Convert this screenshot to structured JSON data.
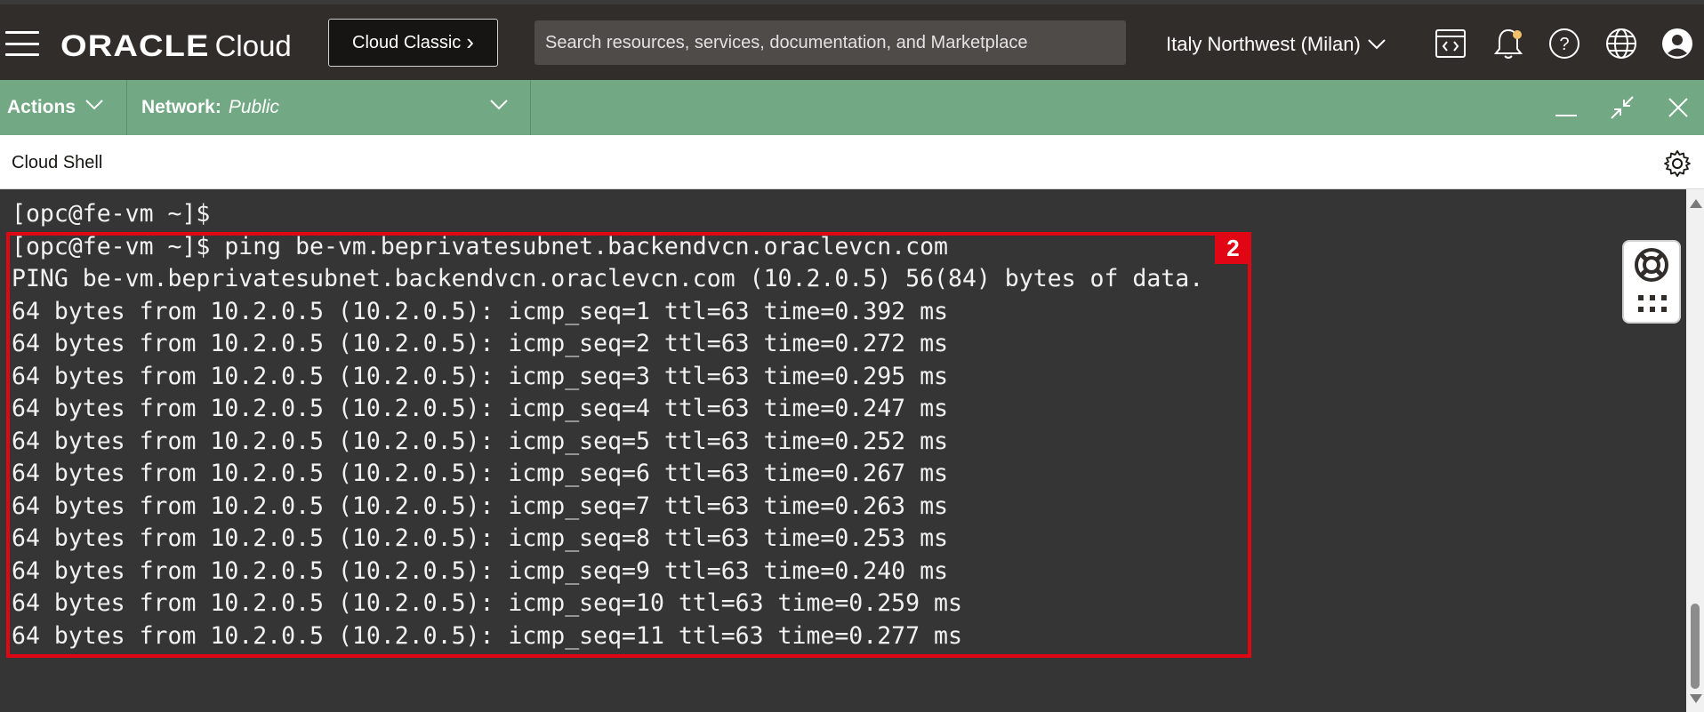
{
  "header": {
    "menu_icon": "hamburger-menu-icon",
    "brand": "ORACLE",
    "product": "Cloud",
    "classic_button_label": "Cloud Classic",
    "search_placeholder": "Search resources, services, documentation, and Marketplace",
    "region": "Italy Northwest (Milan)",
    "icons": [
      "developer-tools-icon",
      "bell-icon",
      "help-icon",
      "globe-icon",
      "user-profile-icon"
    ],
    "notification_dot_color": "#f3c16b"
  },
  "toolbar": {
    "actions_label": "Actions",
    "network_label": "Network:",
    "network_value": "Public",
    "background_color": "#72a883"
  },
  "shell": {
    "title": "Cloud Shell"
  },
  "terminal": {
    "lines": [
      "[opc@fe-vm ~]$",
      "[opc@fe-vm ~]$ ping be-vm.beprivatesubnet.backendvcn.oraclevcn.com",
      "PING be-vm.beprivatesubnet.backendvcn.oraclevcn.com (10.2.0.5) 56(84) bytes of data.",
      "64 bytes from 10.2.0.5 (10.2.0.5): icmp_seq=1 ttl=63 time=0.392 ms",
      "64 bytes from 10.2.0.5 (10.2.0.5): icmp_seq=2 ttl=63 time=0.272 ms",
      "64 bytes from 10.2.0.5 (10.2.0.5): icmp_seq=3 ttl=63 time=0.295 ms",
      "64 bytes from 10.2.0.5 (10.2.0.5): icmp_seq=4 ttl=63 time=0.247 ms",
      "64 bytes from 10.2.0.5 (10.2.0.5): icmp_seq=5 ttl=63 time=0.252 ms",
      "64 bytes from 10.2.0.5 (10.2.0.5): icmp_seq=6 ttl=63 time=0.267 ms",
      "64 bytes from 10.2.0.5 (10.2.0.5): icmp_seq=7 ttl=63 time=0.263 ms",
      "64 bytes from 10.2.0.5 (10.2.0.5): icmp_seq=8 ttl=63 time=0.253 ms",
      "64 bytes from 10.2.0.5 (10.2.0.5): icmp_seq=9 ttl=63 time=0.240 ms",
      "64 bytes from 10.2.0.5 (10.2.0.5): icmp_seq=10 ttl=63 time=0.259 ms",
      "64 bytes from 10.2.0.5 (10.2.0.5): icmp_seq=11 ttl=63 time=0.277 ms"
    ],
    "annotation_badge": "2",
    "annotation_color": "#e00613"
  }
}
